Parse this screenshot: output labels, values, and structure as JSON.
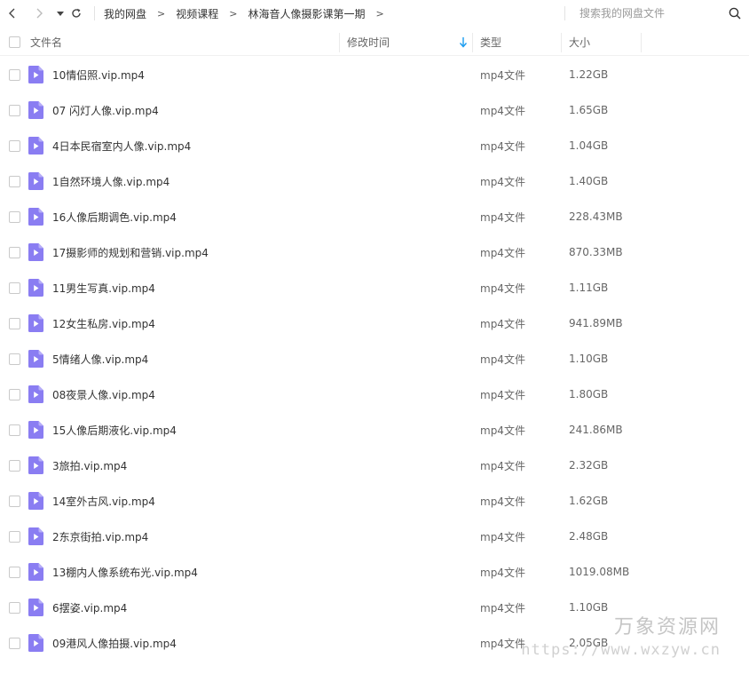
{
  "breadcrumb": [
    "我的网盘",
    "视频课程",
    "林海音人像摄影课第一期"
  ],
  "search": {
    "placeholder": "搜索我的网盘文件"
  },
  "columns": {
    "name": "文件名",
    "mtime": "修改时间",
    "type": "类型",
    "size": "大小"
  },
  "accent_color": "#1a9cf0",
  "file_icon_color": "#8a7df2",
  "files": [
    {
      "name": "10情侣照.vip.mp4",
      "type": "mp4文件",
      "size": "1.22GB"
    },
    {
      "name": "07 闪灯人像.vip.mp4",
      "type": "mp4文件",
      "size": "1.65GB"
    },
    {
      "name": "4日本民宿室内人像.vip.mp4",
      "type": "mp4文件",
      "size": "1.04GB"
    },
    {
      "name": "1自然环境人像.vip.mp4",
      "type": "mp4文件",
      "size": "1.40GB"
    },
    {
      "name": "16人像后期调色.vip.mp4",
      "type": "mp4文件",
      "size": "228.43MB"
    },
    {
      "name": "17摄影师的规划和营销.vip.mp4",
      "type": "mp4文件",
      "size": "870.33MB"
    },
    {
      "name": "11男生写真.vip.mp4",
      "type": "mp4文件",
      "size": "1.11GB"
    },
    {
      "name": "12女生私房.vip.mp4",
      "type": "mp4文件",
      "size": "941.89MB"
    },
    {
      "name": "5情绪人像.vip.mp4",
      "type": "mp4文件",
      "size": "1.10GB"
    },
    {
      "name": "08夜景人像.vip.mp4",
      "type": "mp4文件",
      "size": "1.80GB"
    },
    {
      "name": "15人像后期液化.vip.mp4",
      "type": "mp4文件",
      "size": "241.86MB"
    },
    {
      "name": "3旅拍.vip.mp4",
      "type": "mp4文件",
      "size": "2.32GB"
    },
    {
      "name": "14室外古风.vip.mp4",
      "type": "mp4文件",
      "size": "1.62GB"
    },
    {
      "name": "2东京街拍.vip.mp4",
      "type": "mp4文件",
      "size": "2.48GB"
    },
    {
      "name": "13棚内人像系统布光.vip.mp4",
      "type": "mp4文件",
      "size": "1019.08MB"
    },
    {
      "name": "6摆姿.vip.mp4",
      "type": "mp4文件",
      "size": "1.10GB"
    },
    {
      "name": "09港风人像拍摄.vip.mp4",
      "type": "mp4文件",
      "size": "2.05GB"
    }
  ],
  "watermark": {
    "title": "万象资源网",
    "url": "https://www.wxzyw.cn"
  }
}
